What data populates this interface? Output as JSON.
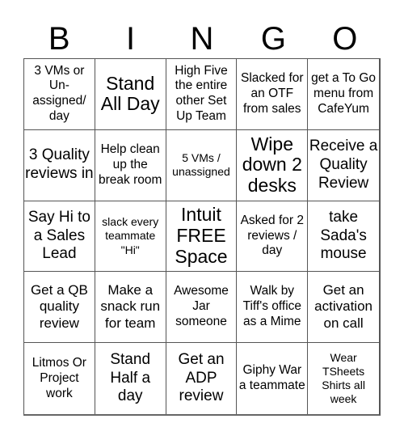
{
  "title_letters": [
    "B",
    "I",
    "N",
    "G",
    "O"
  ],
  "cells": [
    "3 VMs or Un-assigned/ day",
    "Stand All Day",
    "High Five the entire other Set Up Team",
    "Slacked for an OTF from sales",
    "get a To Go menu from CafeYum",
    "3 Quality reviews in",
    "Help clean up the break room",
    "5 VMs / unassigned",
    "Wipe down 2 desks",
    "Receive a Quality Review",
    "Say Hi to a Sales Lead",
    "slack every teammate \"Hi\"",
    "Intuit FREE Space",
    "Asked for 2 reviews / day",
    "take Sada's mouse",
    "Get a QB quality review",
    "Make a snack run for team",
    "Awesome Jar someone",
    "Walk by Tiff's office as a Mime",
    "Get an activation on call",
    "Litmos Or Project work",
    "Stand Half a day",
    "Get an ADP review",
    "Giphy War a teammate",
    "Wear TSheets Shirts all week"
  ]
}
